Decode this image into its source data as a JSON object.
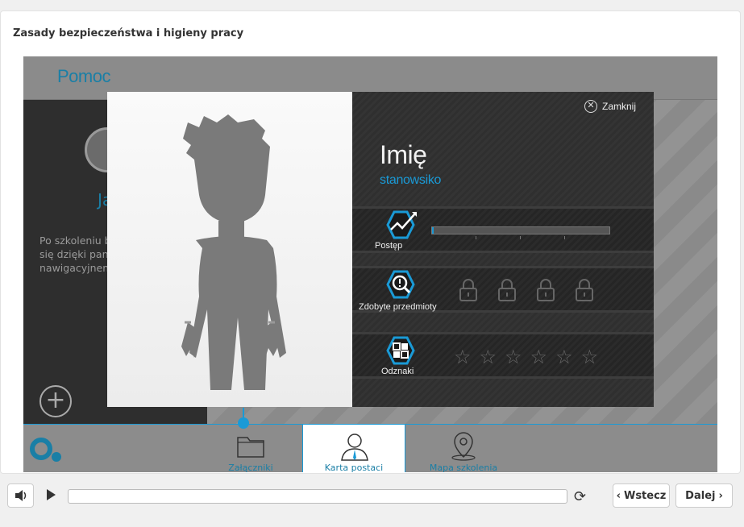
{
  "course": {
    "title": "Zasady bezpieczeństwa i higieny pracy"
  },
  "help": {
    "title": "Pomoc",
    "name_partial": "Ja",
    "text_lines": [
      "Po szkoleniu b",
      "się dzięki pane",
      "nawigacyjnem"
    ]
  },
  "nav": {
    "items": [
      {
        "label": "Załączniki",
        "icon": "folder-icon"
      },
      {
        "label": "Karta postaci",
        "icon": "user-icon"
      },
      {
        "label": "Mapa szkolenia",
        "icon": "map-pin-icon"
      }
    ]
  },
  "modal": {
    "close_label": "Zamknij",
    "name": "Imię",
    "role": "stanowsiko",
    "progress_label": "Postęp",
    "progress_value": 0.01,
    "items_label": "Zdobyte przedmioty",
    "badges_label": "Odznaki",
    "stars_count": 6,
    "stars_glyph": "☆"
  },
  "player": {
    "back_label": "Wstecz",
    "next_label": "Dalej"
  },
  "colors": {
    "accent": "#1a9ad6",
    "dark": "#2e2e2e"
  }
}
